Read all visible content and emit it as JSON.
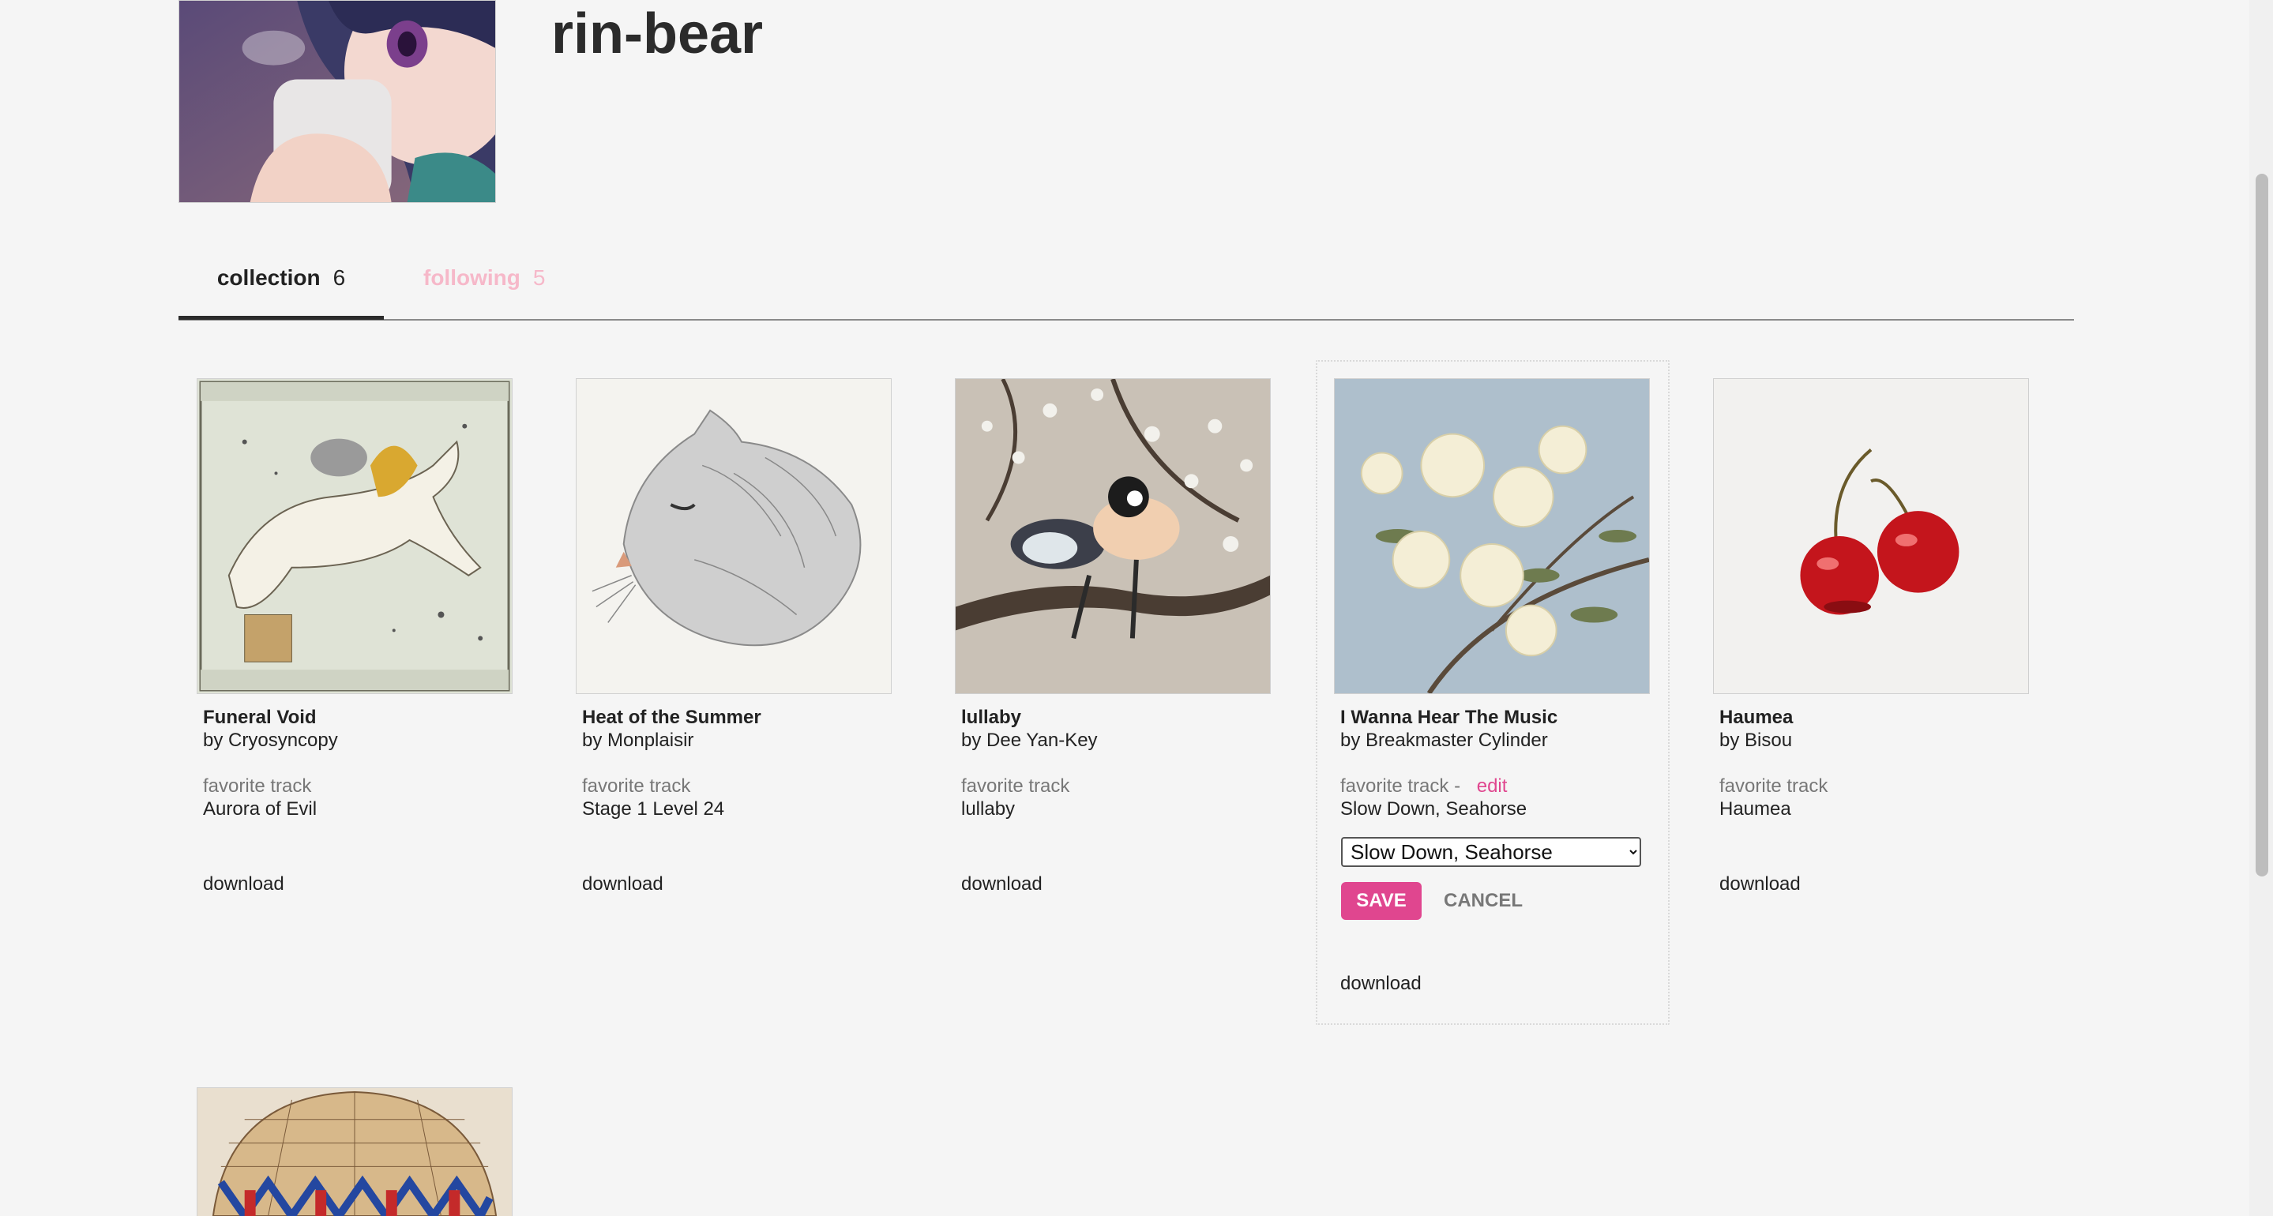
{
  "profile": {
    "username": "rin-bear"
  },
  "tabs": [
    {
      "label": "collection",
      "count": "6"
    },
    {
      "label": "following",
      "count": "5"
    }
  ],
  "collection": [
    {
      "title": "Funeral Void",
      "artist": "by Cryosyncopy",
      "favorite_label": "favorite track",
      "favorite_track": "Aurora of Evil",
      "download": "download",
      "art": "unicorn-constellation"
    },
    {
      "title": "Heat of the Summer",
      "artist": "by Monplaisir",
      "favorite_label": "favorite track",
      "favorite_track": "Stage 1 Level 24",
      "download": "download",
      "art": "cat-sketch"
    },
    {
      "title": "lullaby",
      "artist": "by Dee Yan-Key",
      "favorite_label": "favorite track",
      "favorite_track": "lullaby",
      "download": "download",
      "art": "birds-on-branch"
    },
    {
      "title": "I Wanna Hear The Music",
      "artist": "by Breakmaster Cylinder",
      "favorite_label": "favorite track",
      "favorite_separator": "-",
      "edit_label": "edit",
      "favorite_track": "Slow Down, Seahorse",
      "select_value": "Slow Down, Seahorse",
      "save_label": "SAVE",
      "cancel_label": "CANCEL",
      "download": "download",
      "art": "azalea-flowers"
    },
    {
      "title": "Haumea",
      "artist": "by Bisou",
      "favorite_label": "favorite track",
      "favorite_track": "Haumea",
      "download": "download",
      "art": "cherries"
    }
  ],
  "colors": {
    "accent": "#e0468f",
    "following_tab": "#f6b8c9",
    "background": "#f5f5f5"
  }
}
